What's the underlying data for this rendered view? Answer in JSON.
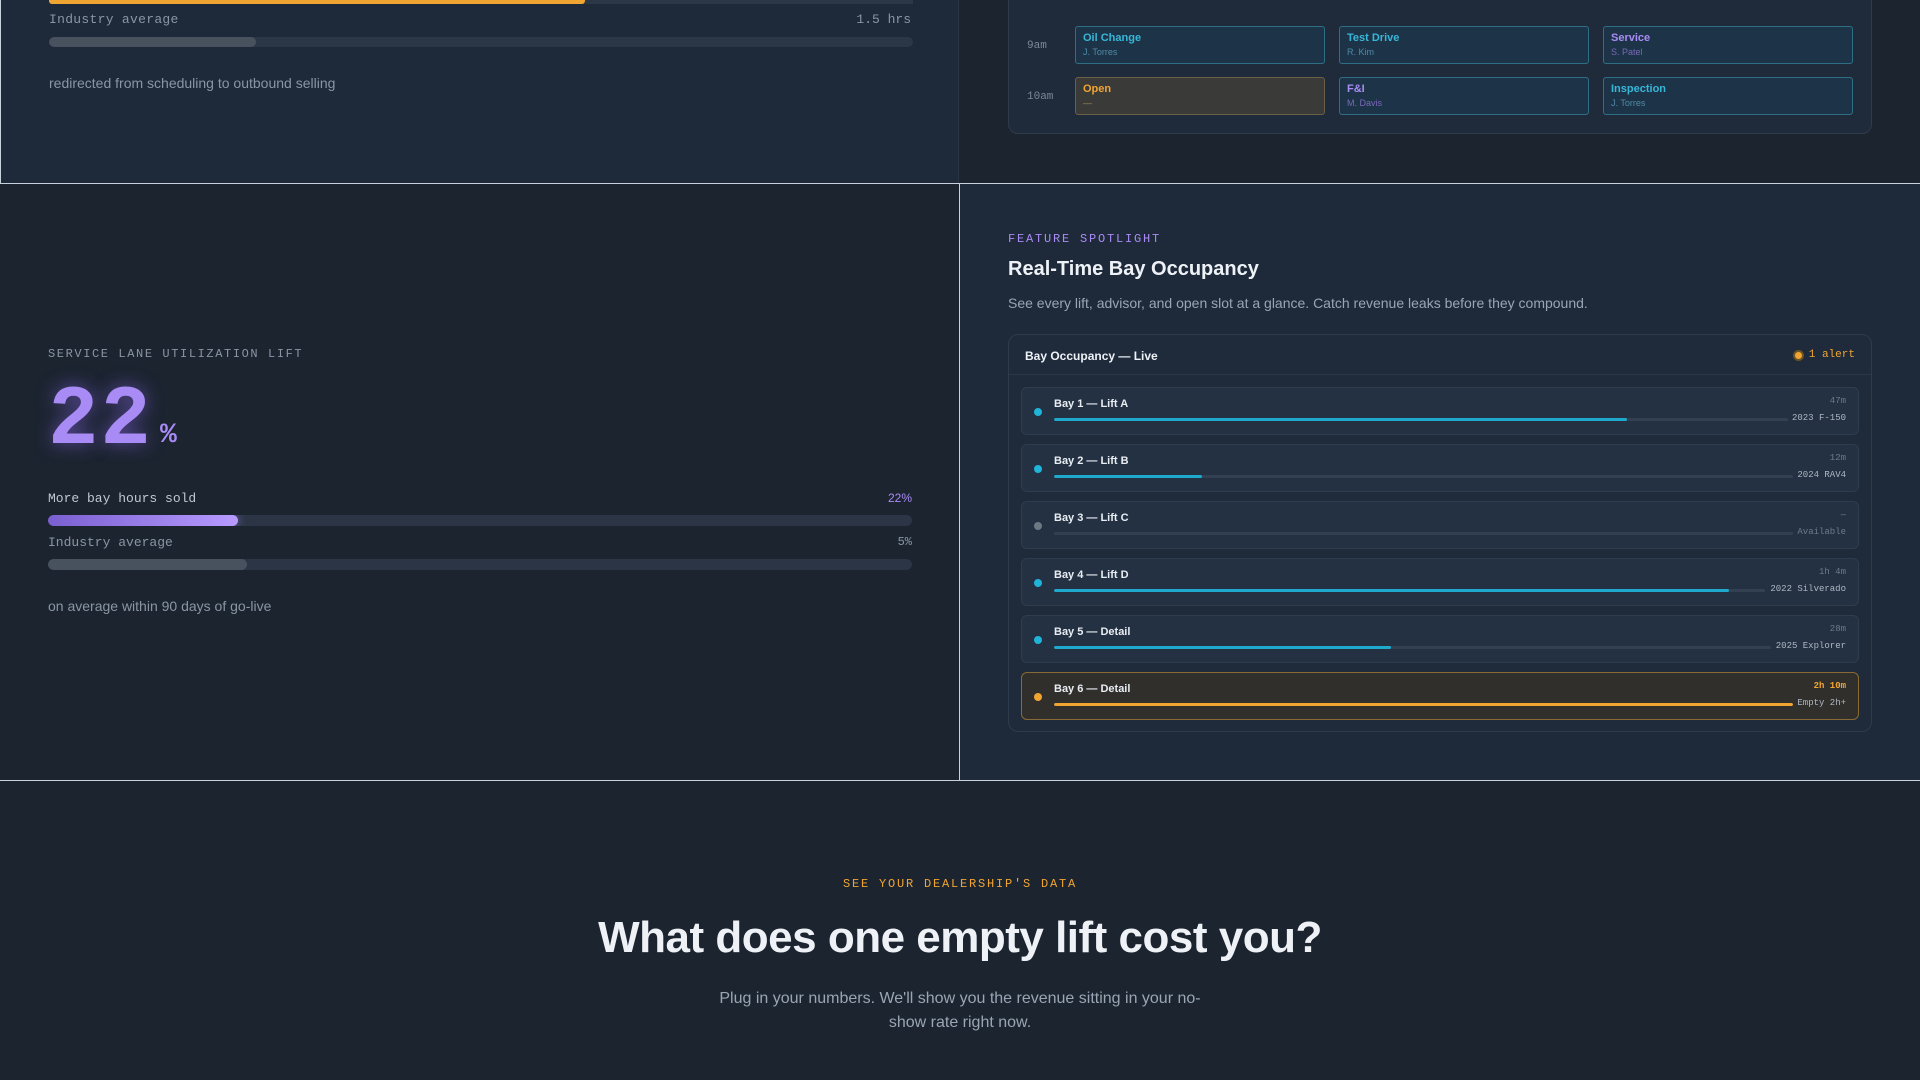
{
  "top_metric": {
    "bar_fill": 0.62,
    "industry_label": "Industry average",
    "industry_value": "1.5 hrs",
    "industry_fill": 0.24,
    "caption": "redirected from scheduling to outbound selling"
  },
  "schedule": {
    "rows": [
      {
        "time": "9am",
        "slots": [
          {
            "title": "Oil Change",
            "person": "J. Torres",
            "style": "booked"
          },
          {
            "title": "Test Drive",
            "person": "R. Kim",
            "style": "booked"
          },
          {
            "title": "Service",
            "person": "S. Patel",
            "style": "purple"
          }
        ]
      },
      {
        "time": "10am",
        "slots": [
          {
            "title": "Open",
            "person": "—",
            "style": "open"
          },
          {
            "title": "F&I",
            "person": "M. Davis",
            "style": "purple"
          },
          {
            "title": "Inspection",
            "person": "J. Torres",
            "style": "booked"
          }
        ]
      }
    ]
  },
  "utilization": {
    "label": "SERVICE LANE UTILIZATION LIFT",
    "value": "22",
    "unit": "%",
    "metrics": [
      {
        "label": "More bay hours sold",
        "value": "22%",
        "fill": 0.22
      },
      {
        "label": "Industry average",
        "value": "5%",
        "fill": 0.23
      }
    ],
    "caption": "on average within 90 days of go-live"
  },
  "feature": {
    "eyebrow": "FEATURE SPOTLIGHT",
    "title": "Real-Time Bay Occupancy",
    "description": "See every lift, advisor, and open slot at a glance. Catch revenue leaks before they compound."
  },
  "occupancy": {
    "title": "Bay Occupancy — Live",
    "alert": "1 alert",
    "bays": [
      {
        "name": "Bay 1 — Lift A",
        "time": "47m",
        "vehicle": "2023 F-150",
        "fill": 0.78,
        "state": "active"
      },
      {
        "name": "Bay 2 — Lift B",
        "time": "12m",
        "vehicle": "2024 RAV4",
        "fill": 0.2,
        "state": "active"
      },
      {
        "name": "Bay 3 — Lift C",
        "time": "—",
        "vehicle": "Available",
        "fill": 0,
        "state": "idle"
      },
      {
        "name": "Bay 4 — Lift D",
        "time": "1h 4m",
        "vehicle": "2022 Silverado",
        "fill": 0.95,
        "state": "active"
      },
      {
        "name": "Bay 5 — Detail",
        "time": "28m",
        "vehicle": "2025 Explorer",
        "fill": 0.47,
        "state": "active"
      },
      {
        "name": "Bay 6 — Detail",
        "time": "2h 10m",
        "vehicle": "Empty 2h+",
        "fill": 1.0,
        "state": "alert"
      }
    ]
  },
  "cta": {
    "eyebrow": "SEE YOUR DEALERSHIP'S DATA",
    "title": "What does one empty lift cost you?",
    "description": "Plug in your numbers. We'll show you the revenue sitting in your no-show rate right now."
  },
  "colors": {
    "accent_purple": "#a98bf5",
    "accent_amber": "#f0a532",
    "accent_cyan": "#1fb4d8",
    "background": "#1c2430"
  }
}
